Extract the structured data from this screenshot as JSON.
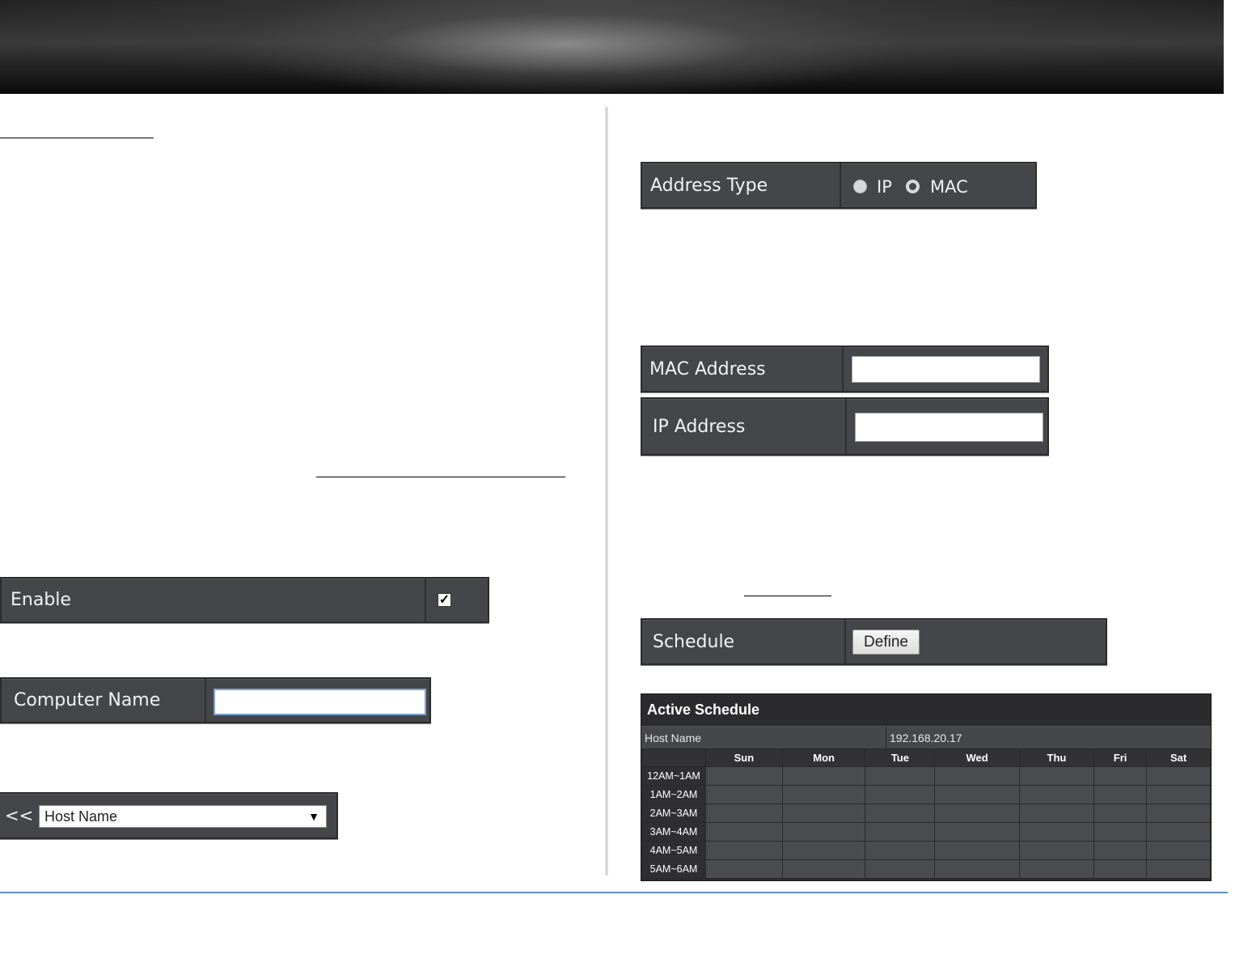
{
  "address_type": {
    "label": "Address Type",
    "options": [
      "IP",
      "MAC"
    ],
    "selected": "MAC"
  },
  "mac_address": {
    "label": "MAC Address",
    "value": ""
  },
  "ip_address": {
    "label": "IP Address",
    "value": ""
  },
  "enable": {
    "label": "Enable",
    "checked": true,
    "check_glyph": "✓"
  },
  "computer_name": {
    "label": "Computer Name",
    "value": ""
  },
  "host_select": {
    "prefix": "<<",
    "selected": "Host Name",
    "arrow": "▼"
  },
  "schedule": {
    "label": "Schedule",
    "button": "Define"
  },
  "active_schedule": {
    "title": "Active Schedule",
    "host_label": "Host Name",
    "host_value": "192.168.20.17",
    "days": [
      "Sun",
      "Mon",
      "Tue",
      "Wed",
      "Thu",
      "Fri",
      "Sat"
    ],
    "times": [
      "12AM~1AM",
      "1AM~2AM",
      "2AM~3AM",
      "3AM~4AM",
      "4AM~5AM",
      "5AM~6AM"
    ]
  }
}
